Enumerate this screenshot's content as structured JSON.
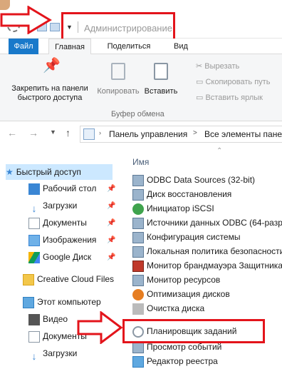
{
  "title": {
    "folder": "Администрирование"
  },
  "tabs": [
    "Файл",
    "Главная",
    "Поделиться",
    "Вид"
  ],
  "ribbon": {
    "pin": "Закрепить на панели быстрого доступа",
    "copy": "Копировать",
    "paste": "Вставить",
    "cut": "Вырезать",
    "copy_path": "Скопировать путь",
    "paste_shortcut": "Вставить ярлык",
    "group": "Буфер обмена"
  },
  "address": {
    "path1": "Панель управления",
    "sep": ">",
    "path2": "Все элементы панел"
  },
  "columns": {
    "name": "Имя"
  },
  "nav": [
    {
      "label": "Быстрый доступ"
    },
    {
      "label": "Рабочий стол"
    },
    {
      "label": "Загрузки"
    },
    {
      "label": "Документы"
    },
    {
      "label": "Изображения"
    },
    {
      "label": "Google Диск"
    },
    {
      "label": "Creative Cloud Files"
    },
    {
      "label": "Этот компьютер"
    },
    {
      "label": "Видео"
    },
    {
      "label": "Документы"
    },
    {
      "label": "Загрузки"
    }
  ],
  "files": [
    "ODBC Data Sources (32-bit)",
    "Диск восстановления",
    "Инициатор iSCSI",
    "Источники данных ODBC (64-разр",
    "Конфигурация системы",
    "Локальная политика безопасности",
    "Монитор брандмауэра Защитника",
    "Монитор ресурсов",
    "Оптимизация дисков",
    "Очистка диска",
    "Планировщик заданий",
    "Просмотр событий",
    "Редактор реестра"
  ],
  "colors": {
    "accent": "#1979ca",
    "highlight": "#e3141b"
  }
}
